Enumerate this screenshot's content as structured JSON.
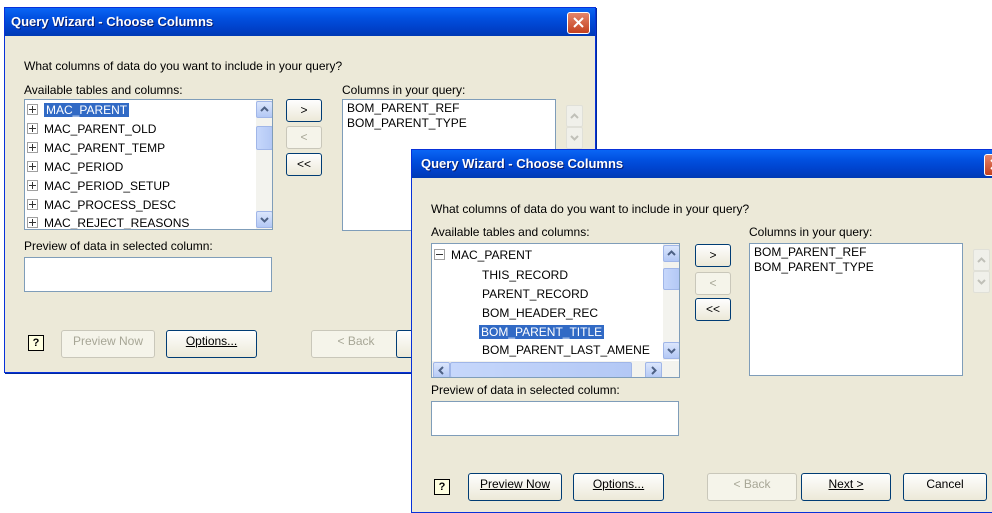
{
  "back_dialog": {
    "title": "Query Wizard - Choose Columns",
    "prompt": "What columns of data do you want to include in your query?",
    "available_label": "Available tables and columns:",
    "available_items": [
      "MAC_PARENT",
      "MAC_PARENT_OLD",
      "MAC_PARENT_TEMP",
      "MAC_PERIOD",
      "MAC_PERIOD_SETUP",
      "MAC_PROCESS_DESC",
      "MAC_REJECT_REASONS"
    ],
    "columns_label": "Columns in your query:",
    "columns_items": [
      "BOM_PARENT_REF",
      "BOM_PARENT_TYPE"
    ],
    "move_right": ">",
    "move_left": "<",
    "move_all_left": "<<",
    "preview_label": "Preview of data in selected column:",
    "help_glyph": "?",
    "preview_now": "Preview Now",
    "options": "Options...",
    "back": "< Back"
  },
  "front_dialog": {
    "title": "Query Wizard - Choose Columns",
    "prompt": "What columns of data do you want to include in your query?",
    "available_label": "Available tables and columns:",
    "tree_root": "MAC_PARENT",
    "tree_children": [
      "THIS_RECORD",
      "PARENT_RECORD",
      "BOM_HEADER_REC",
      "BOM_PARENT_TITLE",
      "BOM_PARENT_LAST_AMENE"
    ],
    "selected_item": "BOM_PARENT_TITLE",
    "columns_label": "Columns in your query:",
    "columns_items": [
      "BOM_PARENT_REF",
      "BOM_PARENT_TYPE"
    ],
    "move_right": ">",
    "move_left": "<",
    "move_all_left": "<<",
    "preview_label": "Preview of data in selected column:",
    "help_glyph": "?",
    "preview_now": "Preview Now",
    "options": "Options...",
    "back": "< Back",
    "next": "Next >",
    "cancel": "Cancel"
  }
}
